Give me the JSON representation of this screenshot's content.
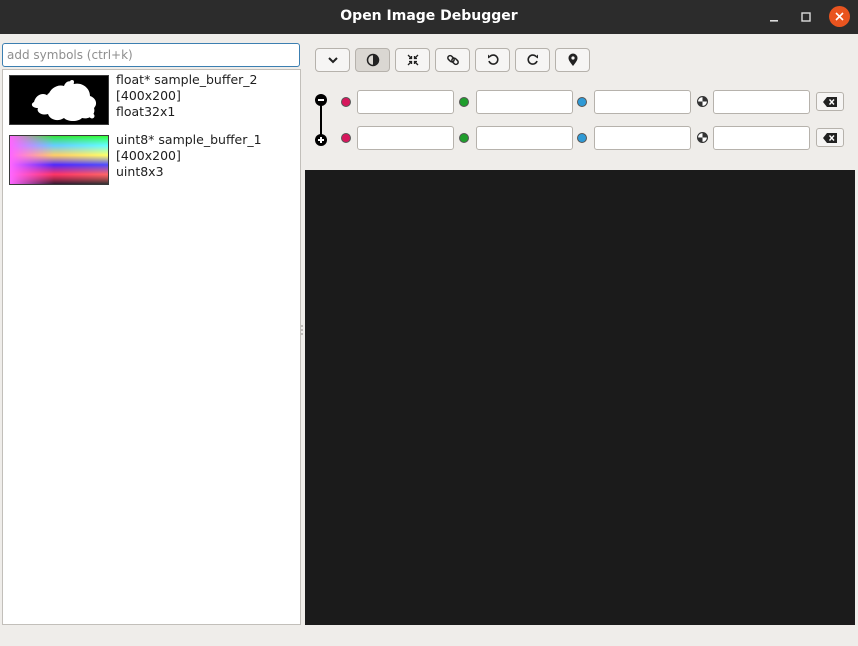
{
  "window": {
    "title": "Open Image Debugger"
  },
  "search": {
    "placeholder": "add symbols (ctrl+k)",
    "value": ""
  },
  "symbols": [
    {
      "name": "float* sample_buffer_2",
      "size": "[400x200]",
      "type": "float32x1"
    },
    {
      "name": "uint8* sample_buffer_1",
      "size": "[400x200]",
      "type": "uint8x3"
    }
  ],
  "toolbar": {
    "buttons": [
      {
        "icon": "chevron-down-icon"
      },
      {
        "icon": "contrast-icon",
        "active": true
      },
      {
        "icon": "shrink-arrows-icon"
      },
      {
        "icon": "link-icon"
      },
      {
        "icon": "rotate-ccw-icon"
      },
      {
        "icon": "rotate-cw-icon"
      },
      {
        "icon": "map-pin-icon"
      }
    ]
  },
  "channels": {
    "colors": {
      "red": "#d6175c",
      "green": "#1f9e2c",
      "blue": "#2f9ad6"
    },
    "min_row": {
      "red": "",
      "green": "",
      "blue": "",
      "alpha": ""
    },
    "max_row": {
      "red": "",
      "green": "",
      "blue": "",
      "alpha": ""
    }
  },
  "canvas": {
    "background": "#1b1b1b"
  }
}
